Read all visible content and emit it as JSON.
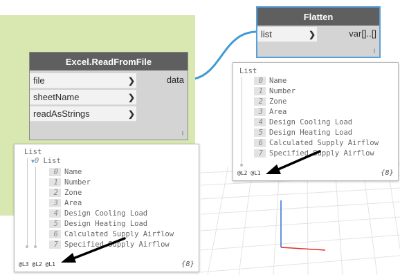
{
  "nodes": {
    "flatten": {
      "title": "Flatten",
      "input": "list",
      "output": "var[]..[]",
      "lacing": "l"
    },
    "excel_read": {
      "title": "Excel.ReadFromFile",
      "inputs": [
        "file",
        "sheetName",
        "readAsStrings"
      ],
      "output": "data",
      "lacing": "l"
    }
  },
  "flatten_preview": {
    "header": "List",
    "items": [
      {
        "index": "0",
        "value": "Name"
      },
      {
        "index": "1",
        "value": "Number"
      },
      {
        "index": "2",
        "value": "Zone"
      },
      {
        "index": "3",
        "value": "Area"
      },
      {
        "index": "4",
        "value": "Design Cooling Load"
      },
      {
        "index": "5",
        "value": "Design Heating Load"
      },
      {
        "index": "6",
        "value": "Calculated Supply Airflow"
      },
      {
        "index": "7",
        "value": "Specified Supply Airflow"
      }
    ],
    "levels": "@L2 @L1",
    "count": "{8}"
  },
  "excel_preview": {
    "header": "List",
    "sublist_index": "0",
    "sublist_header": "List",
    "items": [
      {
        "index": "0",
        "value": "Name"
      },
      {
        "index": "1",
        "value": "Number"
      },
      {
        "index": "2",
        "value": "Zone"
      },
      {
        "index": "3",
        "value": "Area"
      },
      {
        "index": "4",
        "value": "Design Cooling Load"
      },
      {
        "index": "5",
        "value": "Design Heating Load"
      },
      {
        "index": "6",
        "value": "Calculated Supply Airflow"
      },
      {
        "index": "7",
        "value": "Specified Supply Airflow"
      }
    ],
    "levels": "@L3 @L2 @L1",
    "count": "{8}"
  },
  "colors": {
    "group_background": "#d8e8b0",
    "node_header": "#5f5f5f",
    "selected_outline": "#5aa0d8",
    "wire": "#3f9ad6",
    "axis_red": "#e0302a",
    "axis_blue": "#2f6fd6"
  }
}
